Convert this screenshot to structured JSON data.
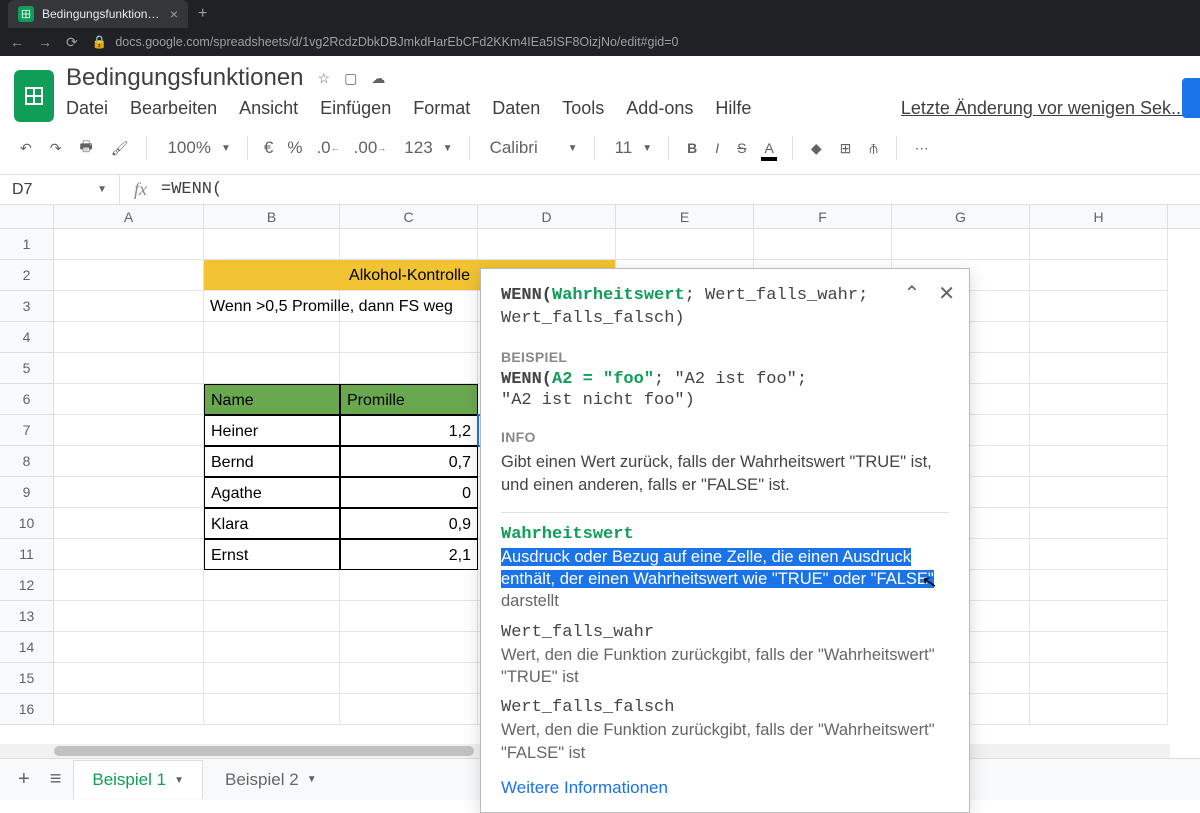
{
  "browser": {
    "tab_title": "Bedingungsfunktionen - Google",
    "url": "docs.google.com/spreadsheets/d/1vg2RcdzDbkDBJmkdHarEbCFd2KKm4IEa5ISF8OizjNo/edit#gid=0"
  },
  "doc": {
    "title": "Bedingungsfunktionen",
    "menus": [
      "Datei",
      "Bearbeiten",
      "Ansicht",
      "Einfügen",
      "Format",
      "Daten",
      "Tools",
      "Add-ons",
      "Hilfe"
    ],
    "last_edit": "Letzte Änderung vor wenigen Sek..."
  },
  "toolbar": {
    "zoom": "100%",
    "currency": "€",
    "percent": "%",
    "dec_less": ".0",
    "dec_more": ".00",
    "num_fmt": "123",
    "font": "Calibri",
    "font_size": "11"
  },
  "formula": {
    "cell_ref": "D7",
    "fx_label": "fx",
    "content": "=WENN("
  },
  "columns": [
    "A",
    "B",
    "C",
    "D",
    "E",
    "F",
    "G",
    "H"
  ],
  "row_numbers": [
    "1",
    "2",
    "3",
    "4",
    "5",
    "6",
    "7",
    "8",
    "9",
    "10",
    "11",
    "12",
    "13",
    "14",
    "15",
    "16"
  ],
  "sheet": {
    "merged_title": "Alkohol-Kontrolle",
    "note": "Wenn >0,5 Promille, dann FS weg",
    "headers": {
      "name": "Name",
      "promille": "Promille"
    },
    "rows": [
      {
        "name": "Heiner",
        "promille": "1,2"
      },
      {
        "name": "Bernd",
        "promille": "0,7"
      },
      {
        "name": "Agathe",
        "promille": "0"
      },
      {
        "name": "Klara",
        "promille": "0,9"
      },
      {
        "name": "Ernst",
        "promille": "2,1"
      }
    ]
  },
  "help": {
    "sig_fn": "WENN(",
    "sig_arg_active": "Wahrheitswert",
    "sig_rest1": "; Wert_falls_wahr;",
    "sig_rest2": "Wert_falls_falsch)",
    "example_label": "BEISPIEL",
    "example_fn": "WENN(",
    "example_arg1": "A2 = \"foo\"",
    "example_rest": "; \"A2 ist foo\";",
    "example_line2": " \"A2 ist nicht foo\")",
    "info_label": "INFO",
    "info_text": "Gibt einen Wert zurück, falls der Wahrheitswert \"TRUE\" ist, und einen anderen, falls er \"FALSE\" ist.",
    "param1_name": "Wahrheitswert",
    "param1_hl1": "Ausdruck oder Bezug auf eine Zelle, die einen Ausdruck",
    "param1_hl2": "enthält, der einen Wahrheitswert wie \"TRUE\" oder \"FALSE\"",
    "param1_tail": "darstellt",
    "param2_name": "Wert_falls_wahr",
    "param2_desc": "Wert, den die Funktion zurückgibt, falls der \"Wahrheitswert\" \"TRUE\" ist",
    "param3_name": "Wert_falls_falsch",
    "param3_desc": "Wert, den die Funktion zurückgibt, falls der \"Wahrheitswert\" \"FALSE\" ist",
    "more": "Weitere Informationen"
  },
  "tabs": {
    "add": "+",
    "list": "≡",
    "sheet1": "Beispiel 1",
    "sheet2": "Beispiel 2"
  }
}
